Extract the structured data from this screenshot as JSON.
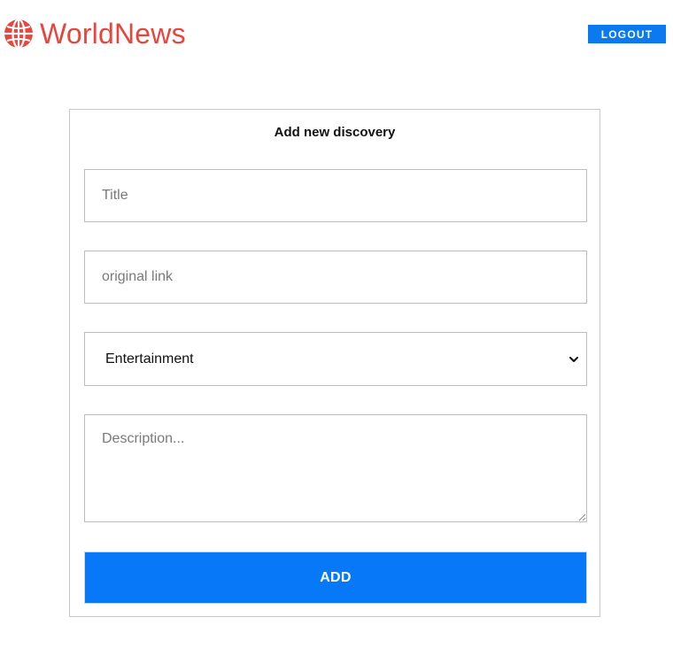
{
  "brand": {
    "name": "WorldNews",
    "color": "#e8453c"
  },
  "header": {
    "logout_label": "LOGOUT"
  },
  "form": {
    "title": "Add new discovery",
    "title_input": {
      "placeholder": "Title",
      "value": ""
    },
    "link_input": {
      "placeholder": "original link",
      "value": ""
    },
    "category_select": {
      "selected": "Entertainment"
    },
    "description": {
      "placeholder": "Description...",
      "value": ""
    },
    "submit_label": "ADD"
  },
  "colors": {
    "accent": "#0678f8",
    "brand": "#e8453c"
  },
  "icons": {
    "brand": "globe-icon",
    "select": "chevron-down-icon"
  }
}
